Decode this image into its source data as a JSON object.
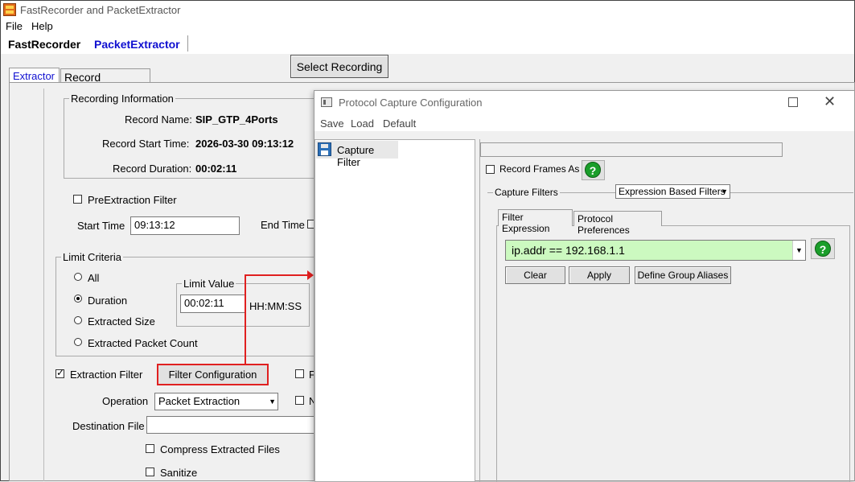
{
  "app": {
    "title": "FastRecorder and PacketExtractor",
    "menu": [
      "File",
      "Help"
    ],
    "tabs": [
      "FastRecorder",
      "PacketExtractor"
    ]
  },
  "toolbar": {
    "select_recording_label": "Select Recording"
  },
  "subtabs": [
    "Extractor",
    "Record Statistics"
  ],
  "recording_info": {
    "title": "Recording Information",
    "name_label": "Record Name:",
    "name_value": "SIP_GTP_4Ports",
    "start_label": "Record Start Time:",
    "start_value": "2026-03-30 09:13:12",
    "duration_label": "Record Duration:",
    "duration_value": "00:02:11"
  },
  "pre_extraction": {
    "label": "PreExtraction Filter",
    "start_time_label": "Start Time",
    "start_time_value": "09:13:12",
    "end_time_label": "End Time"
  },
  "limit_criteria": {
    "title": "Limit Criteria",
    "options": [
      "All",
      "Duration",
      "Extracted Size",
      "Extracted Packet Count"
    ],
    "selected": "Duration",
    "limit_value_title": "Limit Value",
    "limit_value": "00:02:11",
    "limit_unit": "HH:MM:SS"
  },
  "extraction": {
    "filter_label": "Extraction Filter",
    "filter_config_label": "Filter Configuration",
    "operation_label": "Operation",
    "operation_value": "Packet Extraction",
    "destination_label": "Destination File",
    "compress_label": "Compress Extracted Files",
    "sanitize_label": "Sanitize",
    "right_cb1": "F",
    "right_cb2": "N"
  },
  "dialog": {
    "title": "Protocol Capture Configuration",
    "menu": [
      "Save",
      "Load",
      "Default"
    ],
    "tree_item": "Capture Filter",
    "record_frames_label": "Record Frames As Is",
    "capture_filters_label": "Capture Filters",
    "filter_mode": "Expression Based Filters",
    "tabs": [
      "Filter Expression",
      "Protocol Preferences"
    ],
    "expression": "ip.addr == 192.168.1.1",
    "buttons": [
      "Clear",
      "Apply",
      "Define Group Aliases"
    ],
    "help_glyph": "?",
    "expression_bg": "#ccf9c0"
  }
}
